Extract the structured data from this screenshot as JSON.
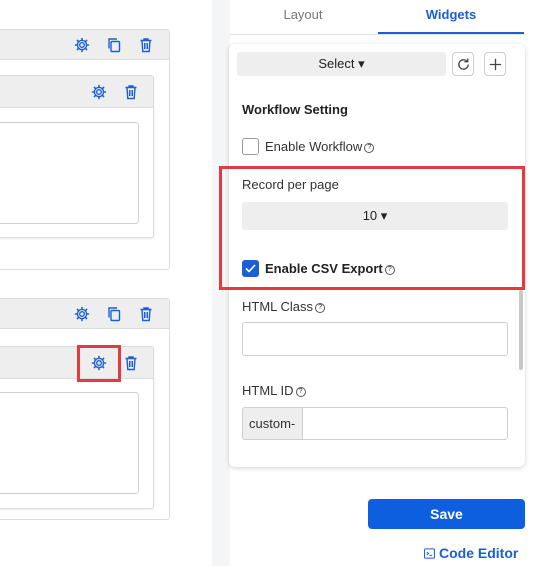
{
  "tabs": {
    "layout": "Layout",
    "widgets": "Widgets"
  },
  "select_button": {
    "label": "Select ▾"
  },
  "workflow": {
    "section_title": "Workflow Setting",
    "enable_workflow_label": "Enable Workflow",
    "enable_workflow_checked": false,
    "record_per_page_label": "Record per page",
    "record_per_page_value": "10 ▾",
    "enable_csv_label": "Enable CSV Export",
    "enable_csv_checked": true
  },
  "html_class": {
    "label": "HTML Class",
    "value": ""
  },
  "html_id": {
    "label": "HTML ID",
    "prefix": "custom-",
    "value": ""
  },
  "actions": {
    "save": "Save",
    "code_editor": "Code Editor"
  },
  "help_glyph": "?",
  "colors": {
    "accent": "#1a5fd6",
    "save_bg": "#0d5fe0",
    "highlight": "#e5393f"
  }
}
